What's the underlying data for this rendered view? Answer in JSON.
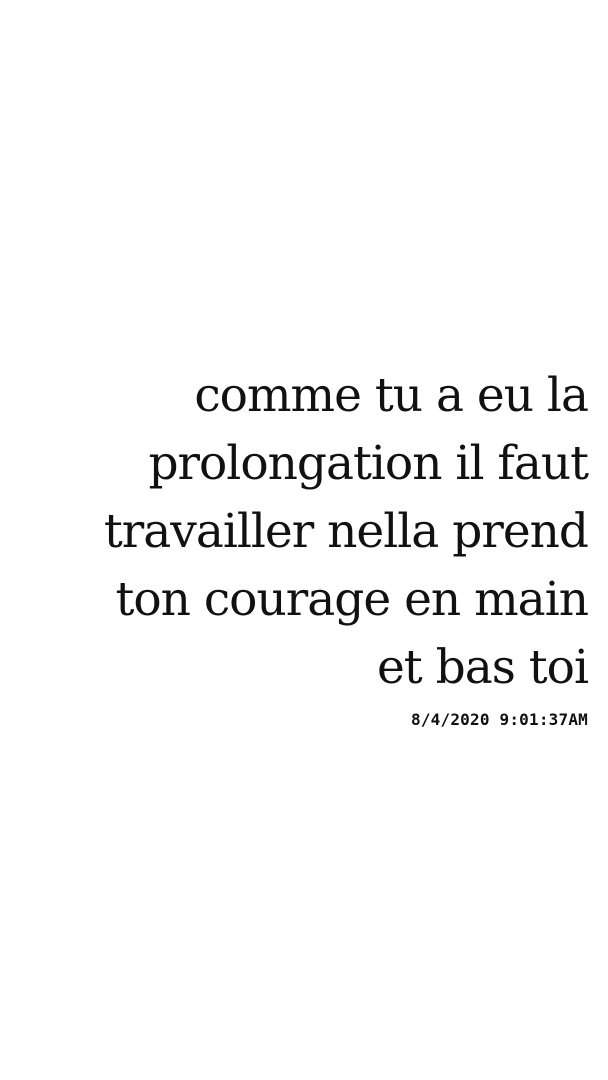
{
  "note": {
    "lines": [
      "comme tu a eu la",
      "prolongation il faut",
      "travailler nella prend",
      "ton courage en main",
      "et bas toi"
    ],
    "timestamp": "8/4/2020 9:01:37AM"
  },
  "colors": {
    "background": "#ffffff",
    "text": "#111111"
  }
}
